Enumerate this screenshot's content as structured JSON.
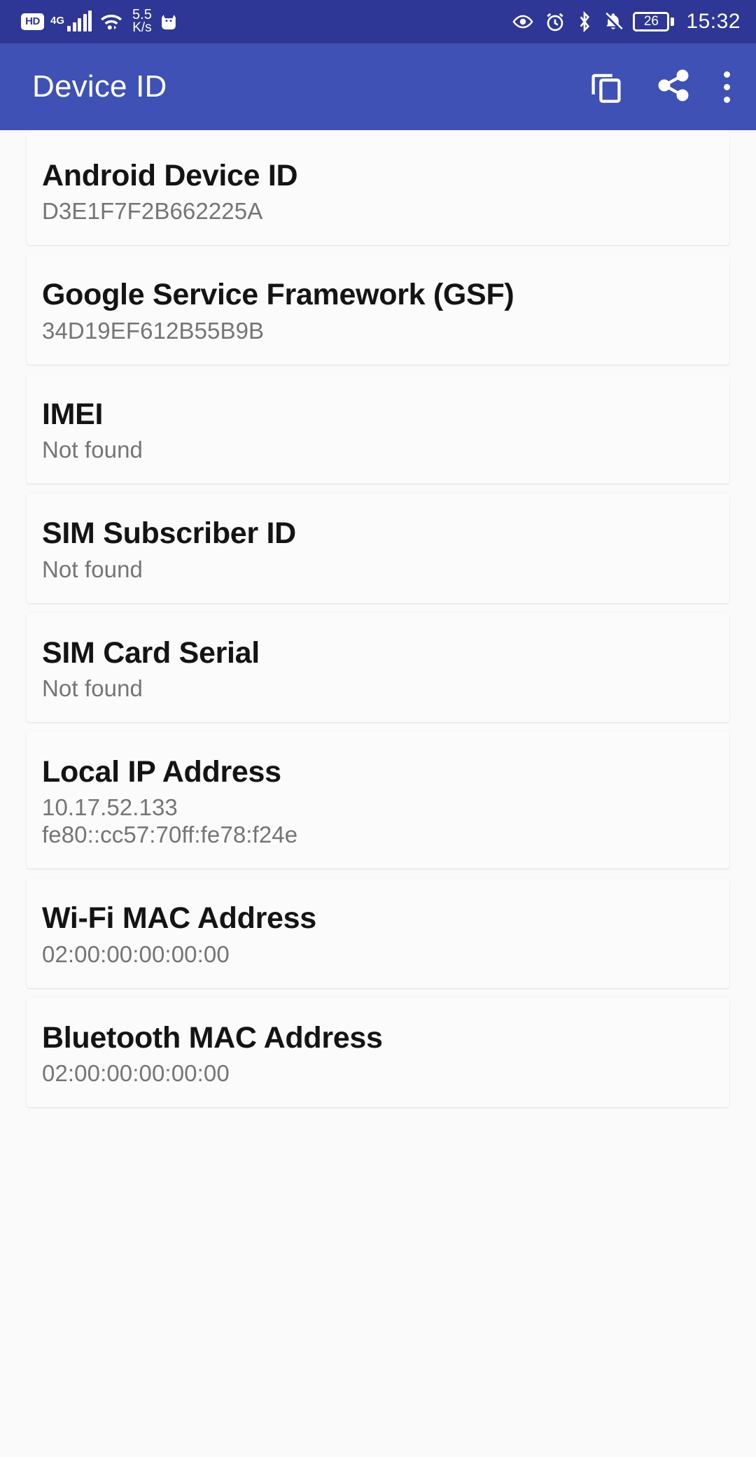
{
  "status_bar": {
    "hd_label": "HD",
    "network_type": "4G",
    "network_icon": "signal-bars-icon",
    "wifi_icon": "wifi-icon",
    "data_speed_value": "5.5",
    "data_speed_unit": "K/s",
    "app_icon": "cat-notification-icon",
    "eye_comfort_icon": "eye-icon",
    "alarm_icon": "alarm-clock-icon",
    "bluetooth_icon": "bluetooth-icon",
    "silent_icon": "bell-muted-icon",
    "battery_percent": "26",
    "time": "15:32"
  },
  "app_bar": {
    "title": "Device ID",
    "copy_label": "copy-icon",
    "share_label": "share-icon",
    "overflow_label": "overflow-menu-icon"
  },
  "items": [
    {
      "label": "Android Device ID",
      "values": [
        "D3E1F7F2B662225A"
      ]
    },
    {
      "label": "Google Service Framework (GSF)",
      "values": [
        "34D19EF612B55B9B"
      ]
    },
    {
      "label": "IMEI",
      "values": [
        "Not found"
      ]
    },
    {
      "label": "SIM Subscriber ID",
      "values": [
        "Not found"
      ]
    },
    {
      "label": "SIM Card Serial",
      "values": [
        "Not found"
      ]
    },
    {
      "label": "Local IP Address",
      "values": [
        "10.17.52.133",
        "fe80::cc57:70ff:fe78:f24e"
      ]
    },
    {
      "label": "Wi-Fi MAC Address",
      "values": [
        "02:00:00:00:00:00"
      ]
    },
    {
      "label": "Bluetooth MAC Address",
      "values": [
        "02:00:00:00:00:00"
      ]
    }
  ],
  "colors": {
    "status_bar_bg": "#2e3795",
    "app_bar_bg": "#3f51b5",
    "page_bg": "#fafafa",
    "card_bg": "#fbfbfb",
    "label_text": "#141414",
    "value_text": "#757575"
  }
}
